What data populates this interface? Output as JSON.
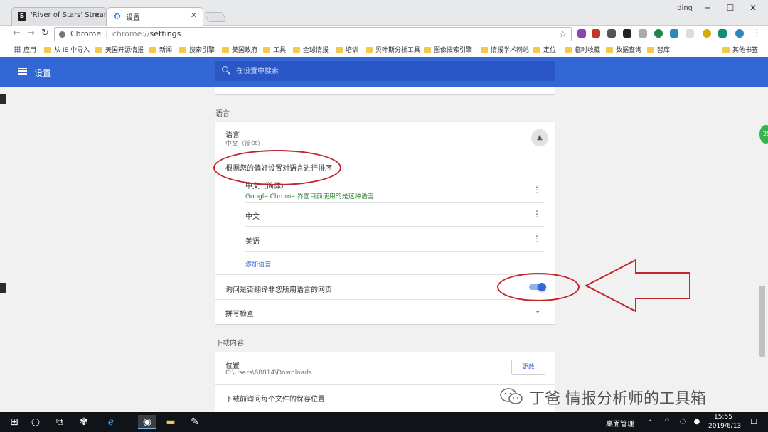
{
  "tabs": [
    {
      "title": "'River of Stars' Streami",
      "favicon": "S"
    },
    {
      "title": "设置",
      "favicon": "gear-icon"
    }
  ],
  "window": {
    "user": "ding",
    "minimize": "─",
    "maximize": "☐",
    "close": "✕"
  },
  "omnibox": {
    "origin": "Chrome",
    "scheme": "chrome://",
    "path": "settings"
  },
  "bookmarks": [
    "应用",
    "从 IE 中导入",
    "美国开源情报",
    "新闻",
    "搜索引擎",
    "美国政府",
    "工具",
    "全球情报",
    "培训",
    "贝叶斯分析工具",
    "图像搜索引擎",
    "情报学术网站",
    "定位",
    "临时收藏",
    "数据查询",
    "智库",
    "其他书签"
  ],
  "header": {
    "title": "设置",
    "search_placeholder": "在设置中搜索"
  },
  "language_section": {
    "heading": "语言",
    "card_title": "语言",
    "card_value": "中文（简体）",
    "order_label": "根据您的偏好设置对语言进行排序",
    "languages": [
      {
        "name": "中文（简体）",
        "note": "Google Chrome 界面目前使用的是这种语言"
      },
      {
        "name": "中文",
        "note": ""
      },
      {
        "name": "美语",
        "note": ""
      }
    ],
    "add_language": "添加语言",
    "translate_offer": "询问是否翻译非您所用语言的网页",
    "translate_enabled": true,
    "spell_check": "拼写检查"
  },
  "downloads_section": {
    "heading": "下载内容",
    "location_label": "位置",
    "location_path": "C:\\Users\\68814\\Downloads",
    "change_button": "更改",
    "ask_where": "下载前询问每个文件的保存位置"
  },
  "floating_badge": "29",
  "watermark": "丁爸 情报分析师的工具箱",
  "taskbar": {
    "desktop_manager": "桌面管理",
    "time": "15:55",
    "date": "2019/6/13"
  }
}
